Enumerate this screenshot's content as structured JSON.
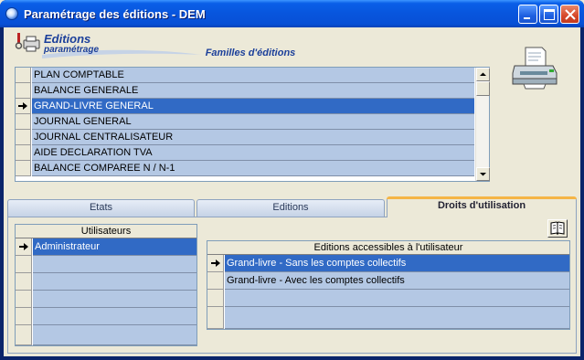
{
  "window": {
    "title": "Paramétrage des éditions - DEM",
    "buttons": [
      "minimize",
      "maximize",
      "close"
    ]
  },
  "header": {
    "logo_title": "Editions",
    "logo_subtitle": "paramétrage",
    "families_title": "Familles d'éditions"
  },
  "families": {
    "selected_index": 2,
    "items": [
      {
        "label": "PLAN COMPTABLE"
      },
      {
        "label": "BALANCE GENERALE"
      },
      {
        "label": "GRAND-LIVRE GENERAL"
      },
      {
        "label": "JOURNAL GENERAL"
      },
      {
        "label": "JOURNAL CENTRALISATEUR"
      },
      {
        "label": "AIDE DECLARATION TVA"
      },
      {
        "label": "BALANCE COMPAREE N / N-1"
      }
    ]
  },
  "tabs": {
    "etats": "Etats",
    "editions": "Editions",
    "droits": "Droits d'utilisation",
    "active": "droits"
  },
  "users": {
    "header": "Utilisateurs",
    "rows": [
      "Administrateur",
      "",
      "",
      "",
      "",
      ""
    ],
    "selected_index": 0
  },
  "accessible": {
    "header": "Editions accessibles à l'utilisateur",
    "rows": [
      "Grand-livre - Sans les comptes collectifs",
      "Grand-livre - Avec les comptes collectifs",
      "",
      ""
    ],
    "selected_index": 0
  },
  "icons": {
    "title": "app-icon",
    "logo": "wrench-printer-icon",
    "printer": "printer-icon",
    "book": "book-icon",
    "row_indicator": "arrow-right-icon"
  },
  "colors": {
    "titlebar": "#0855DD",
    "row_bg": "#B4C8E4",
    "selection": "#316AC5",
    "window_bg": "#ECE9D8",
    "accent_tab": "#F5B546"
  }
}
